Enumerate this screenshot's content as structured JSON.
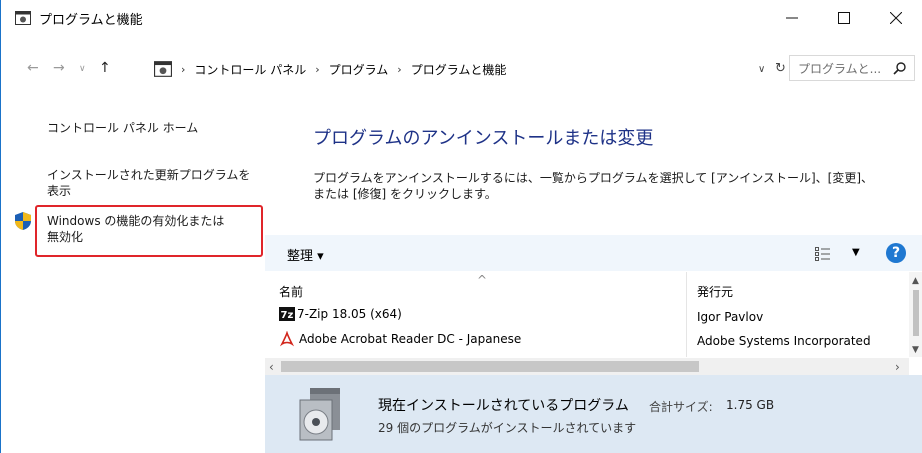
{
  "window": {
    "title": "プログラムと機能"
  },
  "address": {
    "crumbs": [
      "コントロール パネル",
      "プログラム",
      "プログラムと機能"
    ],
    "search_placeholder": "プログラムと... "
  },
  "left_pane": {
    "home": "コントロール パネル ホーム",
    "updates_line1": "インストールされた更新プログラムを",
    "updates_line2": "表示",
    "features_line1": "Windows の機能の有効化または",
    "features_line2": "無効化"
  },
  "main": {
    "title": "プログラムのアンインストールまたは変更",
    "desc_line1": "プログラムをアンインストールするには、一覧からプログラムを選択して [アンインストール]、[変更]、",
    "desc_line2": "または [修復] をクリックします。"
  },
  "toolbar": {
    "organize": "整理 ▾"
  },
  "list": {
    "columns": {
      "name": "名前",
      "publisher": "発行元"
    },
    "rows": [
      {
        "icon": "7zip-icon",
        "name": "7-Zip 18.05 (x64)",
        "publisher": "Igor Pavlov"
      },
      {
        "icon": "acrobat-icon",
        "name": "Adobe Acrobat Reader DC - Japanese",
        "publisher": "Adobe Systems Incorporated"
      }
    ]
  },
  "details": {
    "title": "現在インストールされているプログラム",
    "size_label": "合計サイズ:",
    "size": "1.75 GB",
    "count": "29 個のプログラムがインストールされています"
  },
  "colors": {
    "accent": "#1e3287",
    "highlight_border": "#e0252a",
    "toolbar_bg": "#f0f6fc",
    "details_bg": "#dde8f3"
  }
}
